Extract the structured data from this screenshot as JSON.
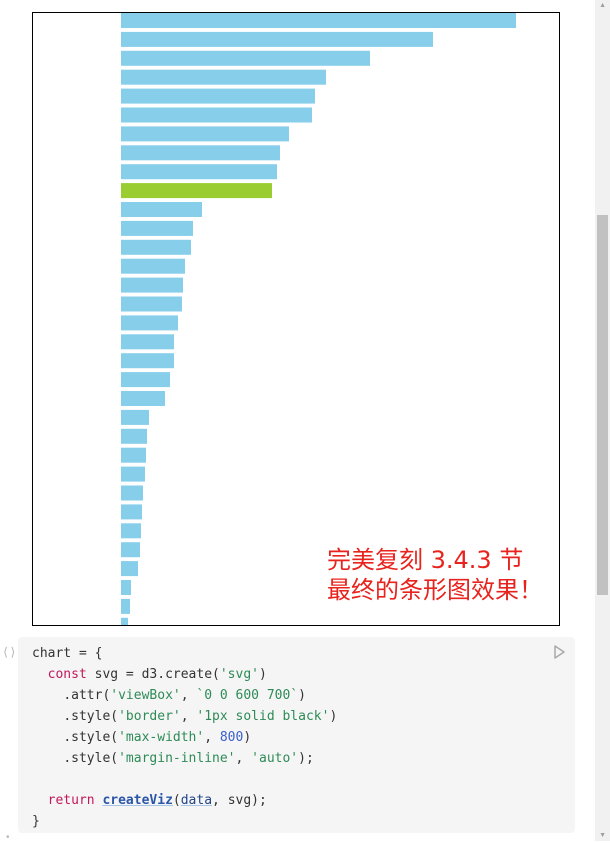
{
  "chart_data": {
    "type": "bar",
    "orientation": "horizontal",
    "values": [
      395,
      312,
      249,
      205,
      194,
      191,
      168,
      159,
      156,
      151,
      81,
      72,
      70,
      64,
      62,
      61,
      57,
      53,
      53,
      49,
      44,
      28,
      26,
      25,
      24,
      22,
      21,
      20,
      19,
      17,
      10,
      9,
      7
    ],
    "highlight_index": 9,
    "colors": {
      "bar": "#87ceeb",
      "highlight": "#9acd32"
    },
    "xlabel": "",
    "ylabel": "",
    "grid": false,
    "legend": false
  },
  "annotation": {
    "line1": "完美复刻 3.4.3 节",
    "line2": "最终的条形图效果！"
  },
  "cell": {
    "gutter_icon": "⟨⟩",
    "run_icon": "play-icon",
    "code": {
      "l1": "chart = {",
      "kw_const": "const",
      "l2_rest": " svg = d3.create(",
      "s_svg": "'svg'",
      "l3_a": ".attr(",
      "s_viewbox": "'viewBox'",
      "l3_b": ", ",
      "s_viewbox_val": "`0 0 600 700`",
      "l3_c": ")",
      "l4_a": ".style(",
      "s_border": "'border'",
      "s_border_val": "'1px solid black'",
      "l5_a": ".style(",
      "s_maxw": "'max-width'",
      "n_800": "800",
      "l6_a": ".style(",
      "s_margin": "'margin-inline'",
      "s_auto": "'auto'",
      "l6_end": ");",
      "kw_return": "return",
      "fn_createviz": "createViz",
      "open_paren": "(",
      "v_data": "data",
      "comma_svg": ", svg);",
      "close": "}"
    }
  }
}
